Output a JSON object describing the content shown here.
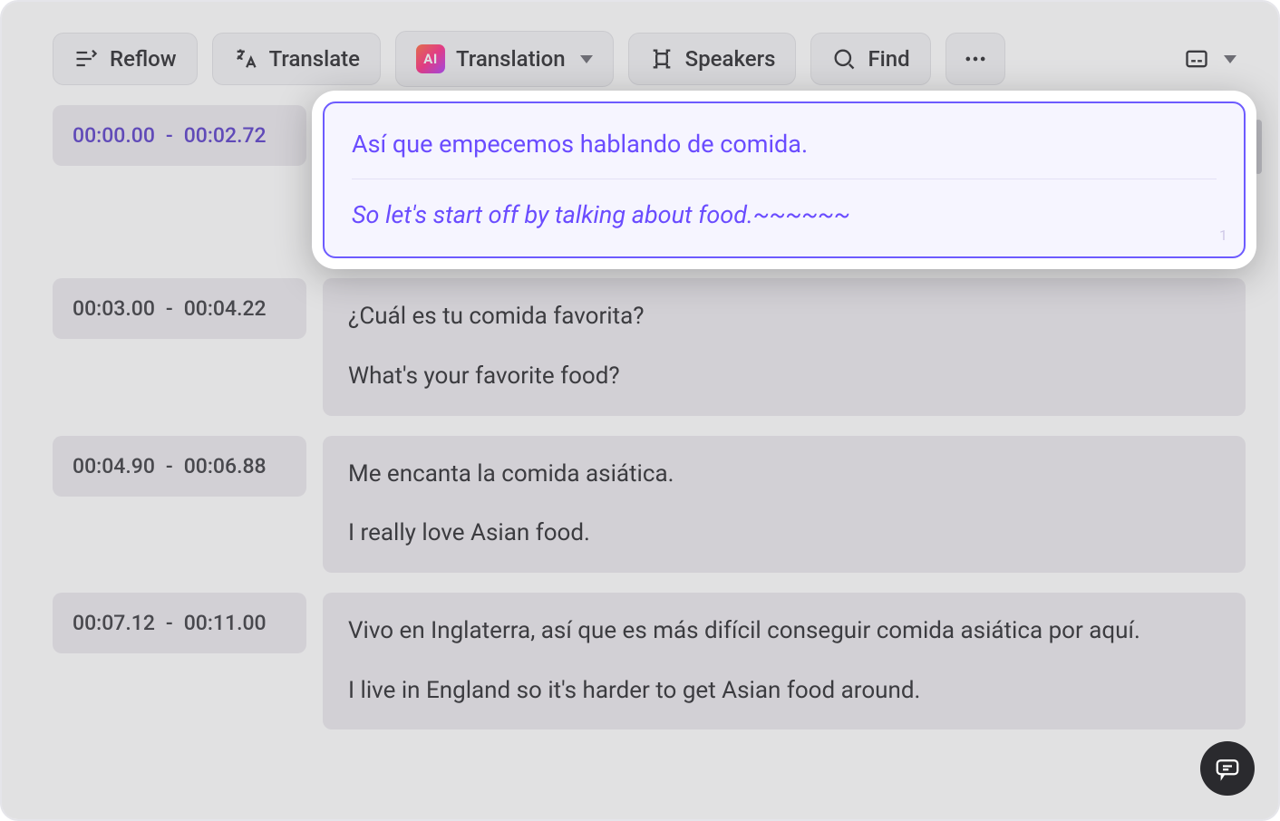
{
  "toolbar": {
    "reflow": "Reflow",
    "translate": "Translate",
    "translation": "Translation",
    "ai_badge": "AI",
    "speakers": "Speakers",
    "find": "Find"
  },
  "segments": [
    {
      "start": "00:00.00",
      "end": "00:02.72",
      "source": "Así que empecemos hablando de comida.",
      "target": "So let's start off by talking about food.~~~~~~",
      "highlighted": true,
      "counter": "1"
    },
    {
      "start": "00:03.00",
      "end": "00:04.22",
      "source": "¿Cuál es tu comida favorita?",
      "target": "What's your favorite food?",
      "highlighted": false
    },
    {
      "start": "00:04.90",
      "end": "00:06.88",
      "source": "Me encanta la comida asiática.",
      "target": "I really love Asian food.",
      "highlighted": false
    },
    {
      "start": "00:07.12",
      "end": "00:11.00",
      "source": "Vivo en Inglaterra, así que es más difícil conseguir comida asiática por aquí.",
      "target": "I live in England so it's harder to get Asian food around.",
      "highlighted": false
    }
  ]
}
